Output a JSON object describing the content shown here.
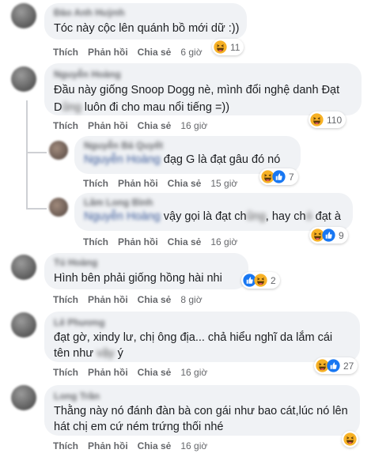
{
  "labels": {
    "like": "Thích",
    "reply": "Phản hồi",
    "share": "Chia sẻ"
  },
  "colors": {
    "bubble": "#f0f2f5",
    "haha": "#f7b125",
    "like": "#1877f2",
    "meta": "#65676b"
  },
  "comments": [
    {
      "author": "Đào Anh Huỳnh",
      "text": "Tóc này cộc lên quánh bồ mới dữ :))",
      "time": "6 giờ",
      "reactions": [
        "haha-icon"
      ],
      "count": "11"
    },
    {
      "author": "Nguyễn Hoàng",
      "line1": "Đầu này giống Snoop Dogg nè, mình đổi nghệ danh Đạt",
      "line2_a": "D",
      "line2_blur": "ũng",
      "line2_b": " luôn đi cho mau nổi tiếng =))",
      "time": "16 giờ",
      "reactions": [
        "haha-icon"
      ],
      "count": "110"
    },
    {
      "author": "Nguyễn Bá Quyết",
      "mention": "Nguyễn Hoàng",
      "text": " đạg G là đạt gâu đó nó",
      "time": "15 giờ",
      "reactions": [
        "haha-icon",
        "like-icon"
      ],
      "count": "7"
    },
    {
      "author": "Lâm Long Bình",
      "mention": "Nguyễn Hoàng",
      "text_a": " vậy gọi là đạt ch",
      "text_blur1": "ũng",
      "text_b": ", hay ch",
      "text_blur2": "ó",
      "text_c": " đạt à",
      "time": "16 giờ",
      "reactions": [
        "haha-icon",
        "like-icon"
      ],
      "count": "9"
    },
    {
      "author": "Tú Hoàng",
      "text": "Hình bên phải giống hồng hài nhi",
      "time": "8 giờ",
      "reactions": [
        "like-icon",
        "haha-icon"
      ],
      "count": "2"
    },
    {
      "author": "Lê Phương",
      "line1": "đạt gờ, xindy lư, chị ông địa... chả hiểu nghĩ da lắm cái",
      "line2_a": "tên như ",
      "line2_blur": "vậy",
      "line2_b": " ý",
      "time": "16 giờ",
      "reactions": [
        "haha-icon",
        "like-icon"
      ],
      "count": "27"
    },
    {
      "author": "Long Trần",
      "line1": "Thằng này nó đánh đàn bà con gái như bao cát,lúc nó lên",
      "line2": "hát chị em cứ ném trứng thối nhé",
      "time": "16 giờ",
      "reactions": [
        "haha-icon"
      ],
      "count": ""
    }
  ]
}
